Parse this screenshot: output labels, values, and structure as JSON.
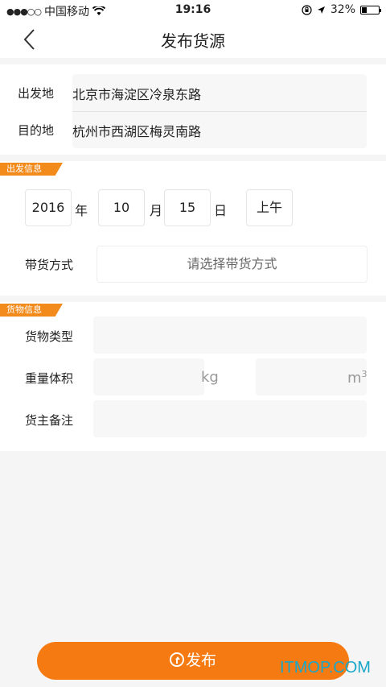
{
  "status_bar": {
    "carrier": "中国移动",
    "time": "19:16",
    "battery": "32%",
    "battery_level": 0.32
  },
  "nav": {
    "title": "发布货源",
    "back_icon": "chevron-left-icon"
  },
  "route": {
    "origin_label": "出发地",
    "origin_value": "北京市海淀区冷泉东路",
    "destination_label": "目的地",
    "destination_value": "杭州市西湖区梅灵南路"
  },
  "depart": {
    "section_tag": "出发信息",
    "year": "2016",
    "year_unit": "年",
    "month": "10",
    "month_unit": "月",
    "day": "15",
    "day_unit": "日",
    "period": "上午",
    "carry_label": "带货方式",
    "carry_placeholder": "请选择带货方式"
  },
  "cargo": {
    "section_tag": "货物信息",
    "type_label": "货物类型",
    "weight_volume_label": "重量体积",
    "weight_unit": "kg",
    "volume_unit": "m",
    "volume_unit_sup": "3",
    "remark_label": "货主备注"
  },
  "publish": {
    "label": "发布",
    "icon": "upload-circle-icon"
  },
  "watermark": "ITMOP.COM",
  "colors": {
    "accent": "#f57a12",
    "tag": "#f28a1c",
    "field_bg": "#f7f7f7",
    "watermark": "#19a7c9"
  }
}
